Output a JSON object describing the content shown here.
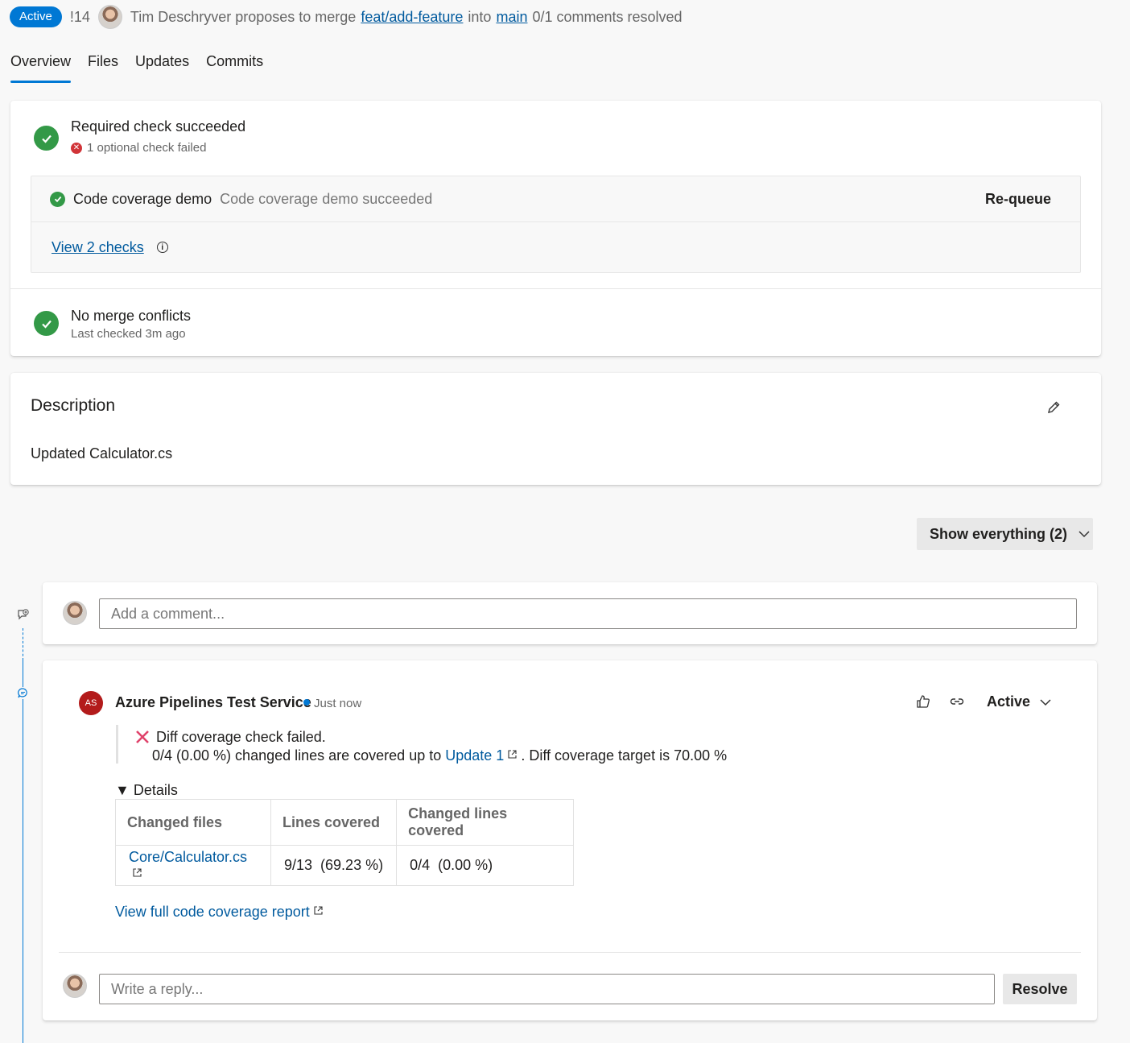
{
  "header": {
    "status_badge": "Active",
    "pr_id": "!14",
    "proposal_prefix": "Tim Deschryver proposes to merge",
    "source_branch": "feat/add-feature",
    "into": "into",
    "target_branch": "main",
    "comments_resolved": "0/1 comments resolved"
  },
  "tabs": [
    "Overview",
    "Files",
    "Updates",
    "Commits"
  ],
  "checks": {
    "required_title": "Required check succeeded",
    "optional_failed": "1 optional check failed",
    "coverage_name": "Code coverage demo",
    "coverage_status": "Code coverage demo succeeded",
    "requeue_label": "Re-queue",
    "view_checks_label": "View 2 checks",
    "merge_title": "No merge conflicts",
    "merge_sub": "Last checked 3m ago"
  },
  "description": {
    "title": "Description",
    "text": "Updated Calculator.cs"
  },
  "filter": {
    "show_label": "Show everything (2)"
  },
  "comment_box": {
    "placeholder": "Add a comment..."
  },
  "thread": {
    "author_initials": "AS",
    "author": "Azure Pipelines Test Service",
    "time": "Just now",
    "status": "Active",
    "failed_title": "Diff coverage check failed.",
    "detail_prefix": "0/4 (0.00 %) changed lines are covered up to",
    "update_link": "Update 1",
    "detail_suffix": ". Diff coverage target is 70.00 %",
    "details_label": "▼ Details",
    "table": {
      "headers": [
        "Changed files",
        "Lines covered",
        "Changed lines covered"
      ],
      "rows": [
        [
          "Core/Calculator.cs",
          "9/13  (69.23 %)",
          "0/4  (0.00 %)"
        ]
      ]
    },
    "full_report_label": "View full code coverage report",
    "reply_placeholder": "Write a reply...",
    "resolve_label": "Resolve"
  },
  "icons": {
    "check": "check-icon",
    "error": "error-icon",
    "info": "info-icon",
    "edit": "edit-icon",
    "like": "like-icon",
    "link": "link-icon",
    "external": "external-link-icon",
    "chevron": "chevron-down-icon"
  },
  "colors": {
    "accent": "#0078d4",
    "success": "#339947",
    "error": "#d13438",
    "link": "#005a9e"
  }
}
